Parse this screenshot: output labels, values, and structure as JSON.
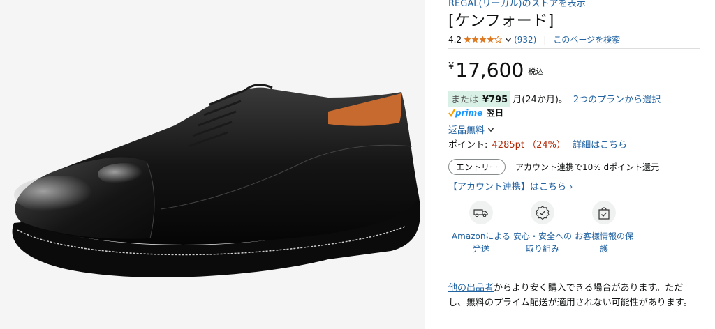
{
  "product": {
    "store_link": "REGAL(リーガル)のストアを表示",
    "title": "[ケンフォード]",
    "rating": "4.2",
    "rating_stars": 4.2,
    "review_count": "(932)",
    "search_page": "このページを検索"
  },
  "price": {
    "currency": "¥",
    "amount": "17,600",
    "tax_label": "税込"
  },
  "installment": {
    "or_label": "または",
    "monthly": "¥795",
    "term": "月(24か月)。",
    "plan_link": "2つのプランから選択"
  },
  "prime": {
    "logo": "prime",
    "delivery": "翌日"
  },
  "returns": {
    "label": "返品無料"
  },
  "points": {
    "label": "ポイント:",
    "value": "4285pt （24%）",
    "details_link": "詳細はこちら"
  },
  "entry": {
    "button": "エントリー",
    "text": "アカウント連携で10% dポイント還元"
  },
  "account_link": "【アカウント連携】はこちら ›",
  "features": [
    {
      "icon": "delivery-van-icon",
      "label_line1": "Amazonによる",
      "label_line2": "発送"
    },
    {
      "icon": "safety-badge-icon",
      "label_line1": "安心・安全への",
      "label_line2": "取り組み"
    },
    {
      "icon": "secure-bag-icon",
      "label_line1": "お客様情報の保",
      "label_line2": "護"
    }
  ],
  "other_sellers": {
    "link": "他の出品者",
    "text": "からより安く購入できる場合があります。ただし、無料のプライム配送が適用されない可能性があります。"
  },
  "colors": {
    "link": "#2162a1",
    "price_red": "#b12704",
    "install_bg": "#d9f0e6",
    "star": "#de7921",
    "prime_blue": "#1a98ff",
    "prime_check": "#f7a100"
  }
}
